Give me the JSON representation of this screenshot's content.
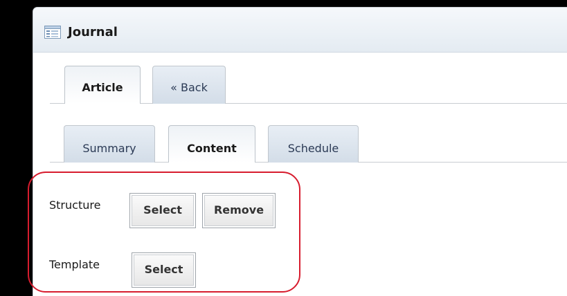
{
  "window": {
    "title": "Journal",
    "icon": "journal-window-icon"
  },
  "top_tabs": [
    {
      "label": "Article",
      "active": true
    },
    {
      "label": "« Back",
      "active": false
    }
  ],
  "sub_tabs": [
    {
      "label": "Summary",
      "active": false
    },
    {
      "label": "Content",
      "active": true
    },
    {
      "label": "Schedule",
      "active": false
    }
  ],
  "structure": {
    "label": "Structure",
    "select_label": "Select",
    "remove_label": "Remove"
  },
  "template": {
    "label": "Template",
    "select_label": "Select"
  },
  "colors": {
    "highlight": "#d71c2e",
    "titlebar": "#e4ebf2",
    "tab_text": "#2b3a55",
    "background": "#000000"
  }
}
